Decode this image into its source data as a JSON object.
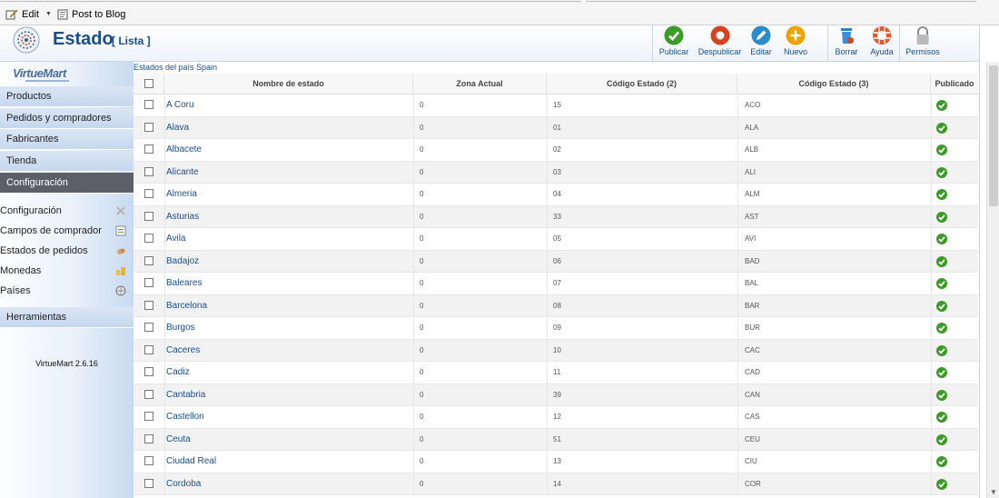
{
  "topbar": {
    "edit_label": "Edit",
    "blog_label": "Post to Blog"
  },
  "header": {
    "title": "Estado",
    "subtitle": "[ Lista ]"
  },
  "toolbar": [
    {
      "label": "Publicar",
      "icon": "publish-icon",
      "color": "#3c9a27"
    },
    {
      "label": "Despublicar",
      "icon": "unpublish-icon",
      "color": "#d9421f"
    },
    {
      "label": "Editar",
      "icon": "edit-icon",
      "color": "#2a8ccf"
    },
    {
      "label": "Nuevo",
      "icon": "new-icon",
      "color": "#f0a300"
    },
    {
      "label": "Borrar",
      "icon": "trash-icon",
      "color": "#2f7fc6"
    },
    {
      "label": "Ayuda",
      "icon": "help-icon",
      "color": "#e0582b"
    },
    {
      "label": "Permisos",
      "icon": "lock-icon",
      "color": "#9a9a9a"
    }
  ],
  "sidebar": {
    "brand": "VirtueMart",
    "menu": [
      {
        "label": "Productos",
        "active": false
      },
      {
        "label": "Pedidos y compradores",
        "active": false
      },
      {
        "label": "Fabricantes",
        "active": false
      },
      {
        "label": "Tienda",
        "active": false
      },
      {
        "label": "Configuración",
        "active": true
      }
    ],
    "sub": [
      {
        "label": "Configuración",
        "icon": "tools-icon"
      },
      {
        "label": "Campos de comprador",
        "icon": "form-icon"
      },
      {
        "label": "Estados de pedidos",
        "icon": "status-icon"
      },
      {
        "label": "Monedas",
        "icon": "coins-icon"
      },
      {
        "label": "Países",
        "icon": "globe-icon"
      }
    ],
    "tools": "Herramientas",
    "version": "VirtueMart 2.6.16"
  },
  "main": {
    "caption": "Estados del país Spain",
    "columns": [
      "Nombre de estado",
      "Zona Actual",
      "Código Estado (2)",
      "Código Estado (3)",
      "Publicado"
    ],
    "rows": [
      [
        "A Coru",
        "0",
        "15",
        "ACO"
      ],
      [
        "Alava",
        "0",
        "01",
        "ALA"
      ],
      [
        "Albacete",
        "0",
        "02",
        "ALB"
      ],
      [
        "Alicante",
        "0",
        "03",
        "ALI"
      ],
      [
        "Almeria",
        "0",
        "04",
        "ALM"
      ],
      [
        "Asturias",
        "0",
        "33",
        "AST"
      ],
      [
        "Avila",
        "0",
        "05",
        "AVI"
      ],
      [
        "Badajoz",
        "0",
        "06",
        "BAD"
      ],
      [
        "Baleares",
        "0",
        "07",
        "BAL"
      ],
      [
        "Barcelona",
        "0",
        "08",
        "BAR"
      ],
      [
        "Burgos",
        "0",
        "09",
        "BUR"
      ],
      [
        "Caceres",
        "0",
        "10",
        "CAC"
      ],
      [
        "Cadiz",
        "0",
        "11",
        "CAD"
      ],
      [
        "Cantabria",
        "0",
        "39",
        "CAN"
      ],
      [
        "Castellon",
        "0",
        "12",
        "CAS"
      ],
      [
        "Ceuta",
        "0",
        "51",
        "CEU"
      ],
      [
        "Ciudad Real",
        "0",
        "13",
        "CIU"
      ],
      [
        "Cordoba",
        "0",
        "14",
        "COR"
      ]
    ]
  }
}
